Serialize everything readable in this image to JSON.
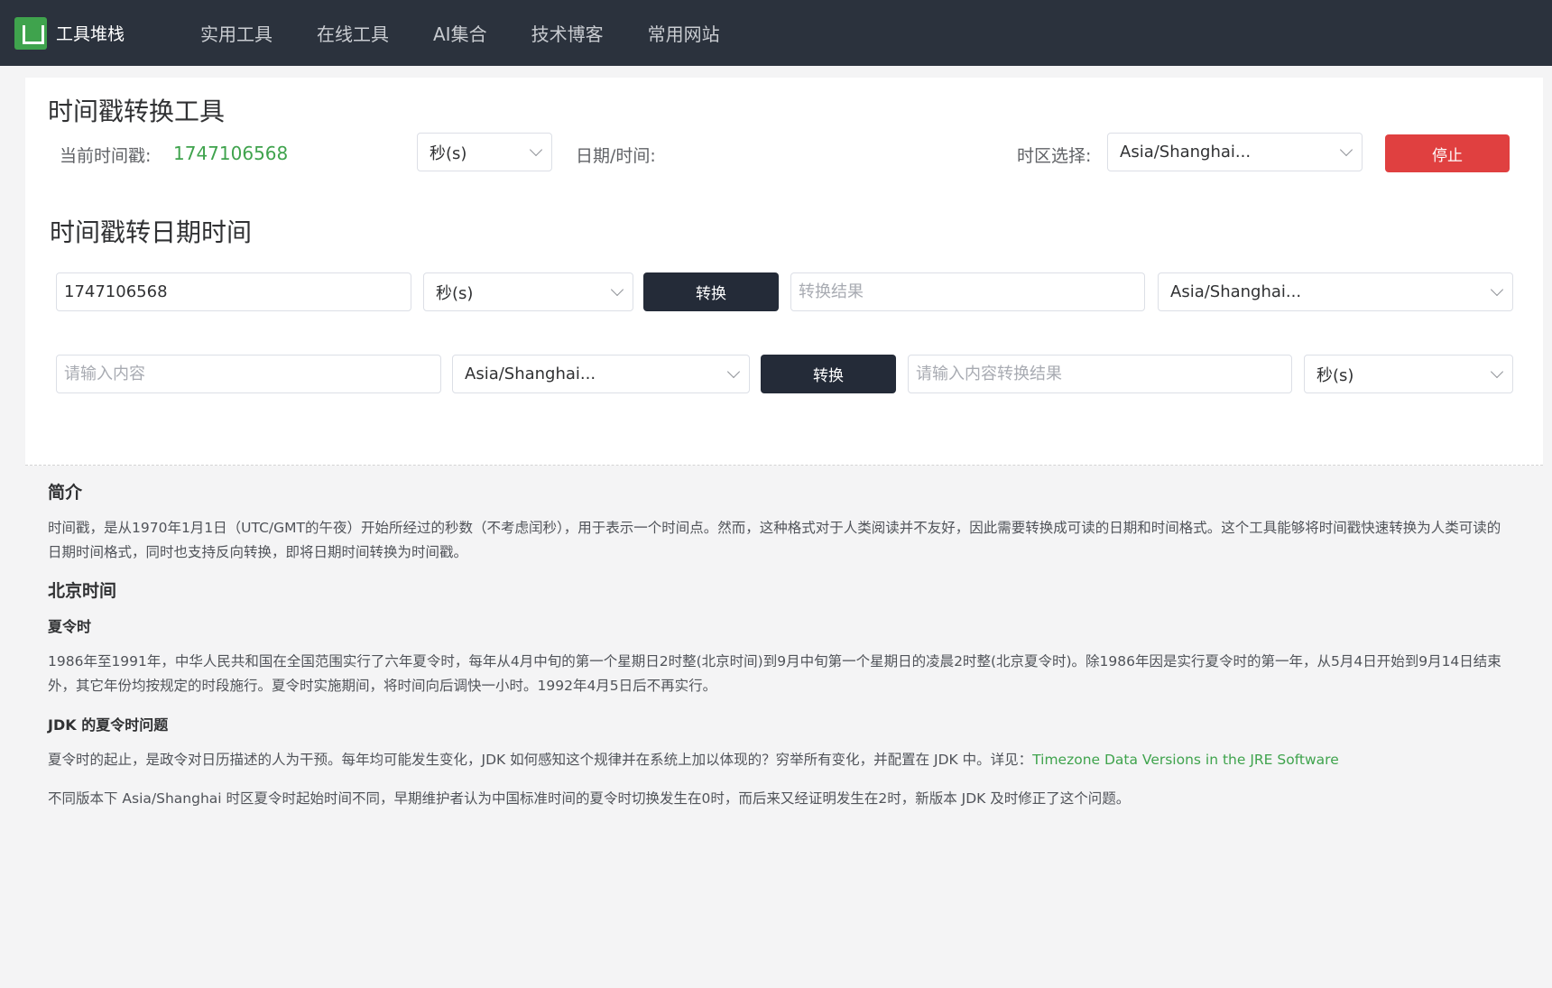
{
  "header": {
    "brand": "工具堆栈",
    "nav": [
      "实用工具",
      "在线工具",
      "AI集合",
      "技术博客",
      "常用网站"
    ]
  },
  "tool": {
    "title": "时间戳转换工具",
    "current_ts_label": "当前时间戳:",
    "current_ts_value": "1747106568",
    "unit_select": "秒(s)",
    "datetime_label": "日期/时间:",
    "timezone_label": "时区选择:",
    "timezone_select": "Asia/Shanghai...",
    "stop_button": "停止"
  },
  "ts_to_date": {
    "title": "时间戳转日期时间",
    "row1": {
      "input_value": "1747106568",
      "unit_select": "秒(s)",
      "convert_button": "转换",
      "result_placeholder": "转换结果",
      "timezone_select": "Asia/Shanghai..."
    },
    "row2": {
      "input_placeholder": "请输入内容",
      "timezone_select": "Asia/Shanghai...",
      "convert_button": "转换",
      "result_placeholder": "请输入内容转换结果",
      "unit_select": "秒(s)"
    }
  },
  "article": {
    "intro_heading": "简介",
    "intro_text": "时间戳，是从1970年1月1日（UTC/GMT的午夜）开始所经过的秒数（不考虑闰秒），用于表示一个时间点。然而，这种格式对于人类阅读并不友好，因此需要转换成可读的日期和时间格式。这个工具能够将时间戳快速转换为人类可读的日期时间格式，同时也支持反向转换，即将日期时间转换为时间戳。",
    "beijing_heading": "北京时间",
    "dst_heading": "夏令时",
    "dst_text": "1986年至1991年，中华人民共和国在全国范围实行了六年夏令时，每年从4月中旬的第一个星期日2时整(北京时间)到9月中旬第一个星期日的凌晨2时整(北京夏令时)。除1986年因是实行夏令时的第一年，从5月4日开始到9月14日结束外，其它年份均按规定的时段施行。夏令时实施期间，将时间向后调快一小时。1992年4月5日后不再实行。",
    "jdk_heading": "JDK 的夏令时问题",
    "jdk_text": "夏令时的起止，是政令对日历描述的人为干预。每年均可能发生变化，JDK 如何感知这个规律并在系统上加以体现的？穷举所有变化，并配置在 JDK 中。详见：",
    "jdk_link": "Timezone Data Versions in the JRE Software",
    "jdk_text2": "不同版本下 Asia/Shanghai 时区夏令时起始时间不同，早期维护者认为中国标准时间的夏令时切换发生在0时，而后来又经证明发生在2时，新版本 JDK 及时修正了这个问题。"
  }
}
